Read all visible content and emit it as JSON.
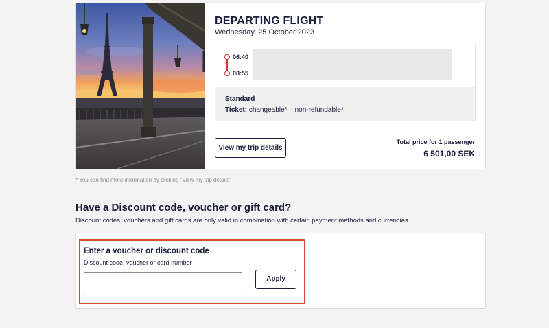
{
  "flight": {
    "title": "DEPARTING FLIGHT",
    "date": "Wednesday, 25 October 2023",
    "departure_time": "06:40",
    "arrival_time": "08:55",
    "fare_name": "Standard",
    "ticket_label": "Ticket:",
    "ticket_value": " changeable* – non-refundable*",
    "trip_details_button": "View my trip details",
    "price_label": "Total price for 1 passenger",
    "price_value": "6 501,00 SEK",
    "image_alt": "Eiffel Tower viewed from Bir-Hakeim bridge at sunset"
  },
  "footnote": "* You can find more information by clicking \"View my trip details\"",
  "discount": {
    "heading": "Have a Discount code, voucher or gift card?",
    "description": "Discount codes, vouchers and gift cards are only valid in combination with certain payment methods and currencies.",
    "field_title": "Enter a voucher or discount code",
    "field_subtitle": "Discount code, voucher or card number",
    "input_value": "",
    "input_placeholder": "",
    "apply_button": "Apply"
  },
  "colors": {
    "accent_red": "#c8342a",
    "highlight_border": "#d94a2e",
    "text_navy": "#1b1f3b",
    "page_bg": "#f3f3f3"
  },
  "icons": {
    "timeline": "route-timeline-icon"
  }
}
